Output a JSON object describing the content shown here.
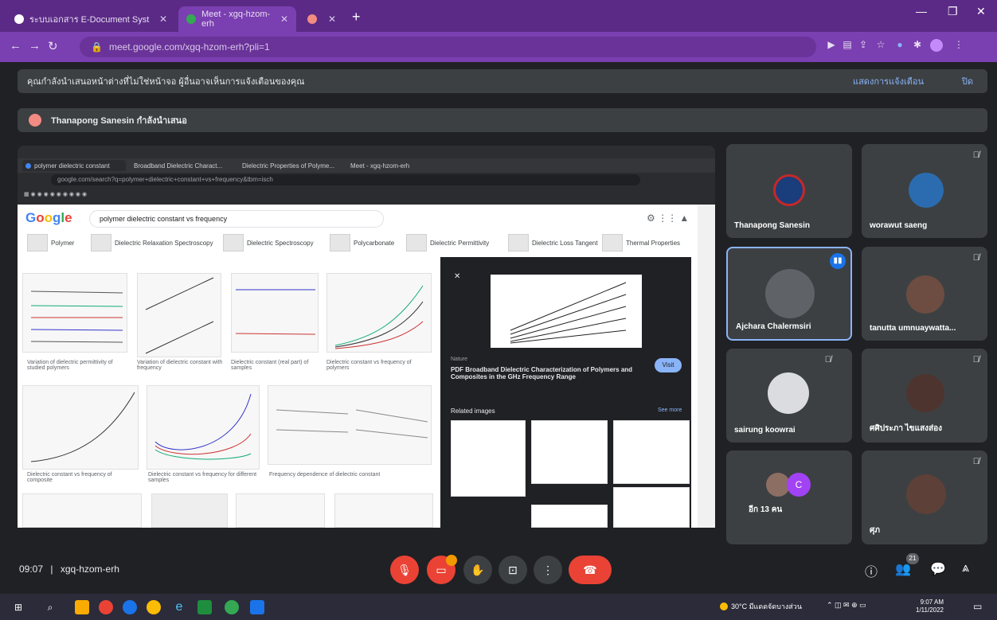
{
  "browser": {
    "tabs": [
      {
        "label": "ระบบเอกสาร E-Document Syst",
        "active": false
      },
      {
        "label": "Meet - xgq-hzom-erh",
        "active": true
      },
      {
        "label": "",
        "active": false
      }
    ],
    "url": "meet.google.com/xgq-hzom-erh?pli=1"
  },
  "meet": {
    "notice_text": "คุณกำลังนำเสนอหน้าต่างที่ไม่ใช่หน้าจอ ผู้อื่นอาจเห็นการแจ้งเตือนของคุณ",
    "notice_action": "แสดงการแจ้งเตือน",
    "notice_close": "ปิด",
    "presenting_text": "Thanapong Sanesin กำลังนำเสนอ",
    "time": "09:07",
    "meeting_code": "xgq-hzom-erh",
    "participant_count": "21",
    "participants": [
      {
        "name": "Thanapong Sanesin",
        "muted": false
      },
      {
        "name": "worawut saeng",
        "muted": true
      },
      {
        "name": "Ajchara Chalermsiri",
        "muted": false,
        "speaking": true
      },
      {
        "name": "tanutta umnuaywatta...",
        "muted": true
      },
      {
        "name": "sairung koowrai",
        "muted": true
      },
      {
        "name": "ศศิประภา ไขแสงส่อง",
        "muted": true
      },
      {
        "name": "อีก 13 คน",
        "muted": false
      },
      {
        "name": "ศุภ",
        "muted": true
      }
    ],
    "other_initial": "C"
  },
  "shared_screen": {
    "tabs": [
      "polymer dielectric constant",
      "Broadband Dielectric Charact...",
      "Dielectric Properties of Polyme...",
      "Meet - xgq-hzom-erh"
    ],
    "url": "google.com/search?q=polymer+dielectric+constant+vs+frequency&tbm=isch",
    "search_query": "polymer dielectric constant vs frequency",
    "chips": [
      "Polymer",
      "Dielectric Relaxation Spectroscopy",
      "Dielectric Spectroscopy",
      "Polycarbonate",
      "Dielectric Permittivity",
      "Dielectric Loss Tangent",
      "Thermal Properties"
    ],
    "side_source": "Nature",
    "side_title": "PDF Broadband Dielectric Characterization of Polymers and Composites in the GHz Frequency Range",
    "side_visit": "Visit",
    "side_related": "Related images",
    "side_see_more": "See more",
    "captions": [
      "Variation of dielectric permittivity of studied polymers",
      "Variation of dielectric constant with frequency",
      "Dielectric constant (real part) of samples",
      "Dielectric constant vs frequency of polymers",
      "Dielectric constant vs frequency of composite",
      "Dielectric constant vs frequency for different samples",
      "Frequency dependence of dielectric constant"
    ]
  },
  "taskbar": {
    "weather": "30°C มีแดดจัดบางส่วน",
    "clock_time": "9:07 AM",
    "clock_date": "1/11/2022"
  },
  "colors": {
    "chrome_purple": "#5b2a86",
    "meet_red": "#ea4335",
    "active_speaker": "#8ab4f8"
  }
}
